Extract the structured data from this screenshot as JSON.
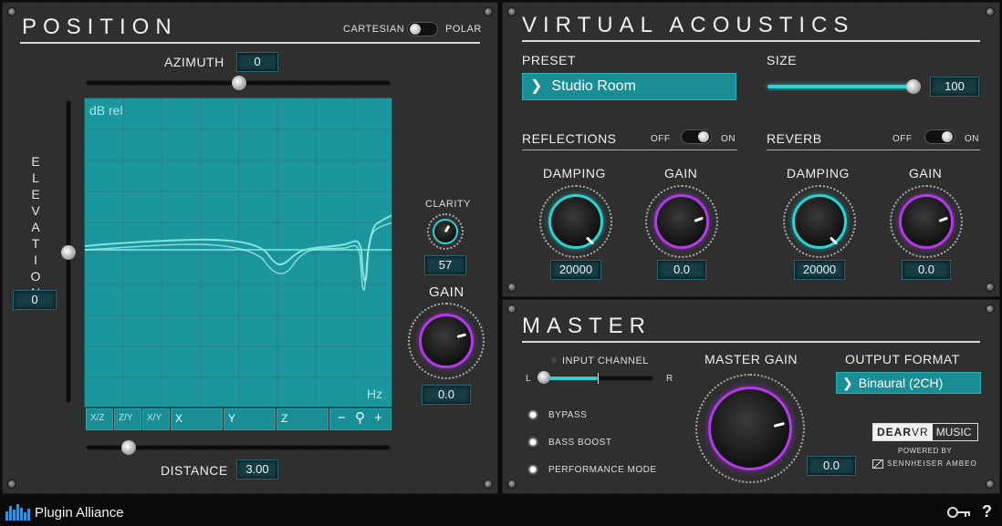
{
  "position": {
    "title": "POSITION",
    "cartesian_label": "CARTESIAN",
    "polar_label": "POLAR",
    "azimuth_label": "AZIMUTH",
    "azimuth_value": "0",
    "azimuth_level": 0.5,
    "elevation_label": "ELEVATION",
    "elevation_value": "0",
    "elevation_level": 0.5,
    "distance_label": "DISTANCE",
    "distance_value": "3.00",
    "distance_level": 0.12,
    "graph_ylabel": "dB rel",
    "graph_xlabel": "Hz",
    "view_buttons": [
      "X/Z",
      "Z/Y",
      "X/Y"
    ],
    "axis_buttons": [
      "X",
      "Y",
      "Z"
    ],
    "zoom_minus": "−",
    "zoom_plus": "+",
    "clarity_label": "CLARITY",
    "clarity_value": "57",
    "gain_label": "GAIN",
    "gain_value": "0.0"
  },
  "virtual_acoustics": {
    "title": "VIRTUAL ACOUSTICS",
    "preset_label": "PRESET",
    "preset_value": "Studio Room",
    "size_label": "SIZE",
    "size_value": "100",
    "size_level": 1.0,
    "reflections": {
      "label": "REFLECTIONS",
      "off": "OFF",
      "on": "ON",
      "damping_label": "DAMPING",
      "damping_value": "20000",
      "gain_label": "GAIN",
      "gain_value": "0.0"
    },
    "reverb": {
      "label": "REVERB",
      "off": "OFF",
      "on": "ON",
      "damping_label": "DAMPING",
      "damping_value": "20000",
      "gain_label": "GAIN",
      "gain_value": "0.0"
    }
  },
  "master": {
    "title": "MASTER",
    "input_channel_label": "INPUT CHANNEL",
    "left": "L",
    "right": "R",
    "bypass": "BYPASS",
    "bass_boost": "BASS BOOST",
    "performance_mode": "PERFORMANCE MODE",
    "master_gain_label": "MASTER GAIN",
    "master_gain_value": "0.0",
    "output_format_label": "OUTPUT FORMAT",
    "output_format_value": "Binaural (2CH)",
    "brand_dear": "DEAR",
    "brand_vr": "VR",
    "brand_music": "MUSIC",
    "powered_by": "POWERED BY",
    "sennheiser": "SENNHEISER AMBEO"
  },
  "footer": {
    "brand": "Plugin Alliance",
    "help": "?"
  },
  "colors": {
    "teal": "#2bd3d3",
    "magenta": "#b13ce6",
    "graph_bg": "#1a969c"
  }
}
